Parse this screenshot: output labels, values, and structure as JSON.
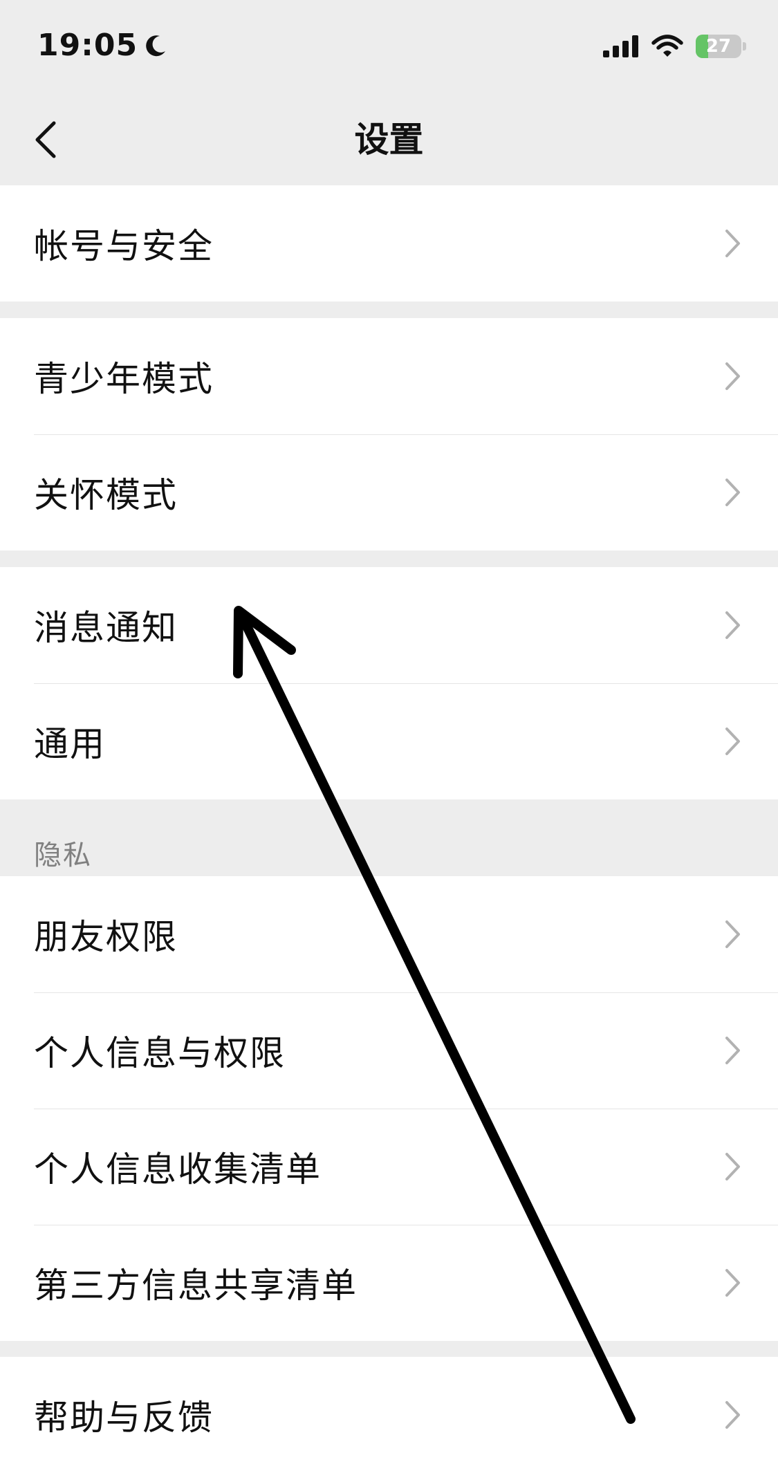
{
  "status_bar": {
    "time": "19:05",
    "battery_level": "27",
    "battery_fraction": 0.27
  },
  "nav": {
    "title": "设置",
    "back_icon": "chevron-left-icon"
  },
  "groups": [
    {
      "items": [
        {
          "label": "帐号与安全"
        }
      ]
    },
    {
      "items": [
        {
          "label": "青少年模式"
        },
        {
          "label": "关怀模式"
        }
      ]
    },
    {
      "items": [
        {
          "label": "消息通知"
        },
        {
          "label": "通用"
        }
      ]
    },
    {
      "header": "隐私",
      "items": [
        {
          "label": "朋友权限"
        },
        {
          "label": "个人信息与权限"
        },
        {
          "label": "个人信息收集清单"
        },
        {
          "label": "第三方信息共享清单"
        }
      ]
    },
    {
      "items": [
        {
          "label": "帮助与反馈"
        }
      ]
    }
  ],
  "colors": {
    "background": "#ededed",
    "cell": "#ffffff",
    "separator": "#e5e5e5",
    "text": "#111111",
    "secondary_text": "#808080",
    "chevron": "#b2b2b2",
    "battery_green": "#65c466",
    "annotation_arrow": "#000000"
  }
}
